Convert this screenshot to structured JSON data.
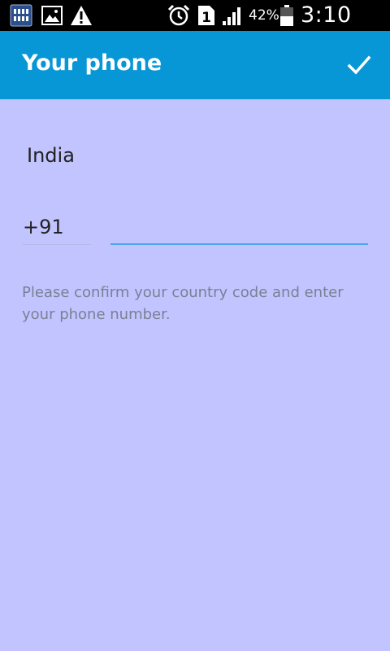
{
  "status_bar": {
    "battery_percent": "42%",
    "time": "3:10 PM",
    "icons": [
      "app-notification-icon",
      "image-icon",
      "warning-icon",
      "alarm-icon",
      "sim-1-icon",
      "signal-icon",
      "battery-icon"
    ],
    "sim_label": "1"
  },
  "app_bar": {
    "title": "Your phone",
    "confirm_icon": "checkmark-icon",
    "background": "#0797d6"
  },
  "form": {
    "country": "India",
    "country_code": "+91",
    "phone_number": "",
    "hint": "Please confirm your country code and enter your phone number."
  },
  "colors": {
    "page_background": "#c2c4ff",
    "accent": "#4aa7e8"
  }
}
